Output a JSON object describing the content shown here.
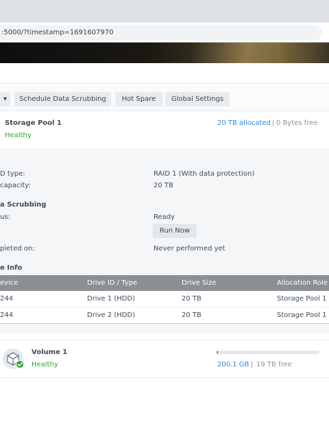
{
  "browser": {
    "url": ":5000/?timestamp=1691607970"
  },
  "toolbar": {
    "dropdown_glyph": "▾",
    "schedule_label": "Schedule Data Scrubbing",
    "hotspare_label": "Hot Spare",
    "global_label": "Global Settings"
  },
  "pool": {
    "title": "Storage Pool 1",
    "status": "Healthy",
    "allocated": "20 TB allocated",
    "separator": "|",
    "free": "0 Bytes free",
    "raid_type_label": "D type:",
    "raid_type_value": "RAID 1 (With data protection)",
    "capacity_label": "capacity:",
    "capacity_value": "20 TB",
    "scrubbing_heading": "a Scrubbing",
    "status_label": "us:",
    "status_value": "Ready",
    "run_now_label": "Run Now",
    "completed_label": "pleted on:",
    "completed_value": "Never performed yet",
    "drive_info_heading": "e Info"
  },
  "drive_table": {
    "headers": [
      "evice",
      "Drive ID / Type",
      "Drive Size",
      "Allocation Role"
    ],
    "rows": [
      [
        "244",
        "Drive 1 (HDD)",
        "20 TB",
        "Storage Pool 1"
      ],
      [
        "244",
        "Drive 2 (HDD)",
        "20 TB",
        "Storage Pool 1"
      ]
    ]
  },
  "volume": {
    "title": "Volume 1",
    "status": "Healthy",
    "used": "200.1 GB",
    "separator": "|",
    "free": "19 TB free",
    "usage_fraction": 0.01,
    "icon": "volume-cube-icon",
    "badge_icon": "check-icon"
  },
  "colors": {
    "accent": "#2f8ad6",
    "healthy": "#2fa52f",
    "table_header": "#8b9096"
  }
}
